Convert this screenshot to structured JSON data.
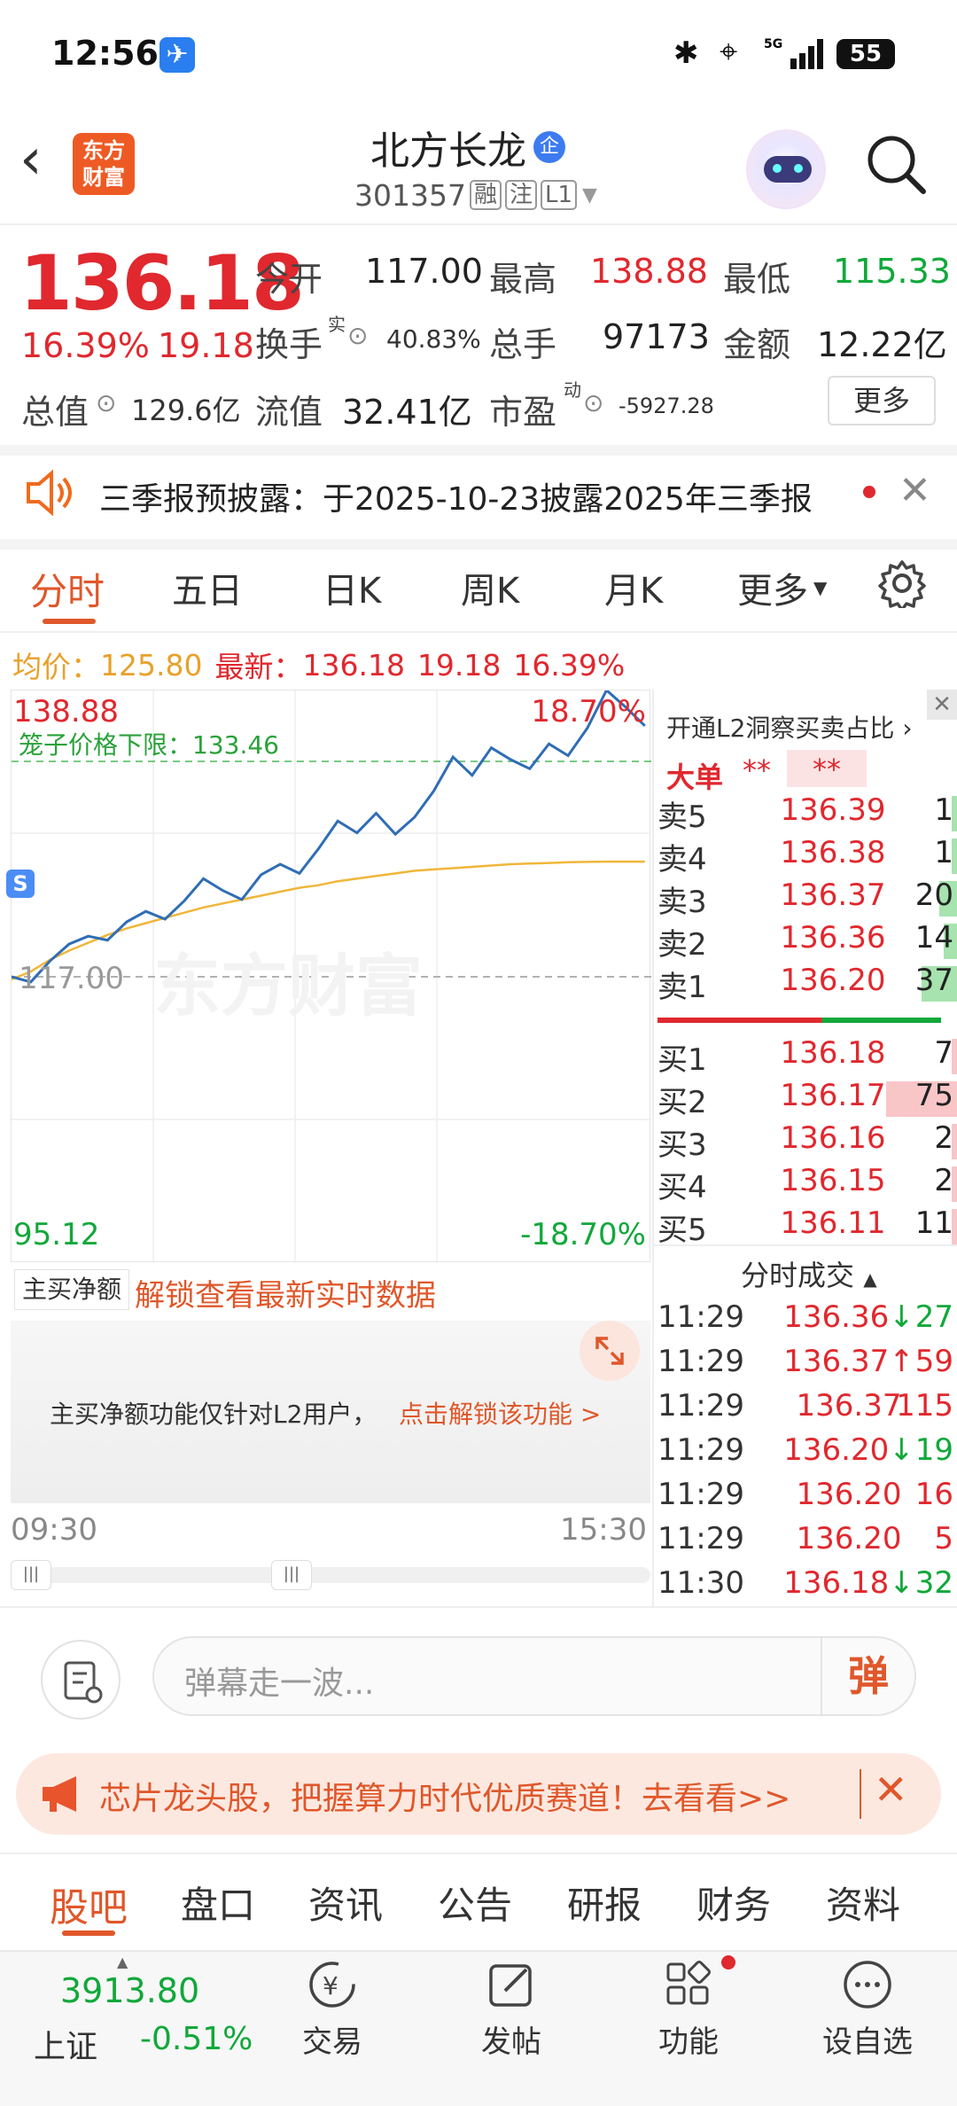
{
  "status_bar": {
    "time": "12:56",
    "battery": "55"
  },
  "header": {
    "back_icon": "chevron-left-icon",
    "logo_text_1": "东方",
    "logo_text_2": "财富",
    "stock_name": "北方长龙",
    "badge": "企",
    "stock_code": "301357",
    "tags": [
      "融",
      "注",
      "L1"
    ],
    "search_icon": "search-icon"
  },
  "quote": {
    "price": "136.18",
    "change_pct": "16.39%",
    "change_amt": "19.18",
    "open_label": "今开",
    "open": "117.00",
    "high_label": "最高",
    "high": "138.88",
    "low_label": "最低",
    "low": "115.33",
    "turnover_label": "换手",
    "turnover_sup": "实",
    "turnover": "40.83%",
    "volume_label": "总手",
    "volume": "97173",
    "amount_label": "金额",
    "amount": "12.22亿",
    "mktcap_label": "总值",
    "mktcap": "129.6亿",
    "float_label": "流值",
    "float": "32.41亿",
    "pe_label": "市盈",
    "pe_sup": "动",
    "pe": "-5927.28",
    "more": "更多"
  },
  "notice": {
    "text": "三季报预披露：于2025-10-23披露2025年三季报"
  },
  "tabs": [
    "分时",
    "五日",
    "日K",
    "周K",
    "月K",
    "更多"
  ],
  "tabs_active": 0,
  "chart_header": {
    "avg_label": "均价：",
    "avg": "125.80",
    "latest_label": "最新：",
    "latest": "136.18",
    "latest_chg": "19.18",
    "latest_pct": "16.39%"
  },
  "chart_labels": {
    "top_price": "138.88",
    "top_pct": "18.70%",
    "cage_text": "笼子价格下限：133.46",
    "mid_price": "117.00",
    "bottom_price": "95.12",
    "bottom_pct": "-18.70%",
    "time_start": "09:30",
    "time_end": "15:30",
    "s_marker": "S",
    "watermark": "东方财富"
  },
  "chart_data": {
    "type": "line",
    "ylim": [
      95.12,
      138.88
    ],
    "reference": 117.0,
    "session_minutes": 240,
    "series": [
      {
        "values": [
          117.0,
          116.6,
          118.2,
          119.5,
          120.1,
          119.8,
          121.2,
          122.0,
          121.4,
          122.8,
          124.5,
          123.6,
          122.9,
          124.8,
          125.6,
          124.9,
          126.8,
          128.9,
          128.0,
          129.5,
          127.9,
          129.2,
          131.2,
          133.8,
          132.4,
          134.5,
          133.6,
          132.9,
          134.8,
          133.9,
          136.0,
          138.9,
          137.6,
          136.18
        ]
      },
      {
        "values": [
          116.8,
          117.4,
          118.3,
          119.0,
          119.6,
          120.2,
          120.7,
          121.1,
          121.5,
          121.9,
          122.3,
          122.6,
          122.9,
          123.2,
          123.5,
          123.8,
          124.0,
          124.3,
          124.5,
          124.7,
          124.9,
          125.1,
          125.2,
          125.3,
          125.4,
          125.5,
          125.6,
          125.65,
          125.7,
          125.75,
          125.78,
          125.8,
          125.8,
          125.8
        ]
      }
    ]
  },
  "orderbook": {
    "title": "开通L2洞察买卖占比",
    "big_order_label": "大单",
    "big_buy": "**",
    "big_sell": "**",
    "asks": [
      {
        "label": "卖5",
        "price": "136.39",
        "vol": "1",
        "ratio": 0.02
      },
      {
        "label": "卖4",
        "price": "136.38",
        "vol": "1",
        "ratio": 0.02
      },
      {
        "label": "卖3",
        "price": "136.37",
        "vol": "20",
        "ratio": 0.2
      },
      {
        "label": "卖2",
        "price": "136.36",
        "vol": "14",
        "ratio": 0.15
      },
      {
        "label": "卖1",
        "price": "136.20",
        "vol": "37",
        "ratio": 0.4
      }
    ],
    "bids": [
      {
        "label": "买1",
        "price": "136.18",
        "vol": "7",
        "ratio": 0.05
      },
      {
        "label": "买2",
        "price": "136.17",
        "vol": "75",
        "ratio": 0.8
      },
      {
        "label": "买3",
        "price": "136.16",
        "vol": "2",
        "ratio": 0.02
      },
      {
        "label": "买4",
        "price": "136.15",
        "vol": "2",
        "ratio": 0.02
      },
      {
        "label": "买5",
        "price": "136.11",
        "vol": "11",
        "ratio": 0.06
      }
    ]
  },
  "ticks": {
    "title": "分时成交",
    "rows": [
      {
        "time": "11:29",
        "price": "136.36",
        "arrow": "↓",
        "vol": "27",
        "color": "green"
      },
      {
        "time": "11:29",
        "price": "136.37",
        "arrow": "↑",
        "vol": "59",
        "color": "red"
      },
      {
        "time": "11:29",
        "price": "136.37",
        "arrow": "",
        "vol": "115",
        "color": "red"
      },
      {
        "time": "11:29",
        "price": "136.20",
        "arrow": "↓",
        "vol": "19",
        "color": "green"
      },
      {
        "time": "11:29",
        "price": "136.20",
        "arrow": "",
        "vol": "16",
        "color": "red"
      },
      {
        "time": "11:29",
        "price": "136.20",
        "arrow": "",
        "vol": "5",
        "color": "red"
      },
      {
        "time": "11:30",
        "price": "136.18",
        "arrow": "↓",
        "vol": "32",
        "color": "green"
      }
    ]
  },
  "net_buy": {
    "select_label": "主买净额",
    "unlock_link": "解锁查看最新实时数据",
    "locked_text": "主买净额功能仅针对L2用户，",
    "locked_link": "点击解锁该功能 >"
  },
  "danmaku": {
    "placeholder": "弹幕走一波...",
    "button": "弹"
  },
  "banner": {
    "text": "芯片龙头股，把握算力时代优质赛道！去看看>>"
  },
  "bottom_tabs": [
    "股吧",
    "盘口",
    "资讯",
    "公告",
    "研报",
    "财务",
    "资料"
  ],
  "bottom_tabs_active": 0,
  "dock": {
    "index_value": "3913.80",
    "index_name": "上证",
    "index_change": "-0.51%",
    "items": [
      "交易",
      "发帖",
      "功能",
      "设自选"
    ]
  },
  "colors": {
    "up": "#e0282e",
    "down": "#11a83a",
    "accent": "#f06a1d",
    "price_line": "#2f6db5",
    "avg_line": "#f0b63a"
  }
}
